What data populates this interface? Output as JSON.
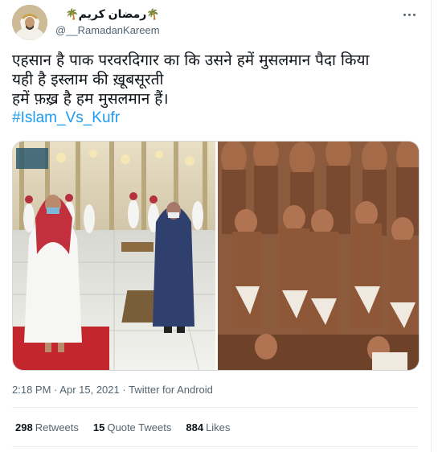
{
  "tweet": {
    "display_name": "رمضان كريم",
    "palm_emoji": "🌴",
    "handle": "@__RamadanKareem",
    "text_lines": [
      "एहसान है पाक परवरदिगार का कि उसने हमें मुसलमान पैदा किया",
      "यही है इस्लाम की ख़ूबसूरती",
      "हमें फ़ख़्र है हम मुसलमान हैं।"
    ],
    "hashtag": "#Islam_Vs_Kufr",
    "time": "2:18 PM",
    "date": "Apr 15, 2021",
    "source": "Twitter for Android",
    "separator": "·",
    "stats": {
      "retweets_count": "298",
      "retweets_label": "Retweets",
      "quotes_count": "15",
      "quotes_label": "Quote Tweets",
      "likes_count": "884",
      "likes_label": "Likes"
    }
  },
  "icons": {
    "more": "more-options-icon"
  },
  "colors": {
    "accent": "#1d9bf0",
    "text": "#0f1419",
    "muted": "#536471",
    "border": "#e6ecf0"
  }
}
